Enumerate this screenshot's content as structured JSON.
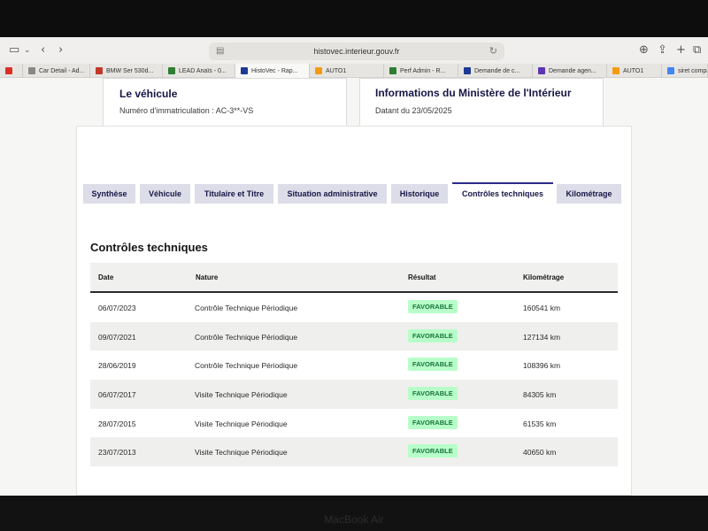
{
  "browser": {
    "url": "histovec.interieur.gouv.fr",
    "tabs": [
      {
        "label": "",
        "fav": "#d93025",
        "icon": "gmail-icon"
      },
      {
        "label": "Car Detail - Ad...",
        "fav": "#888888",
        "icon": "w-icon"
      },
      {
        "label": "BMW Ser 530d...",
        "fav": "#c0392b",
        "icon": "bmw-icon"
      },
      {
        "label": "LEAD Anaïs - 0...",
        "fav": "#2e7d32",
        "icon": "sheet-icon"
      },
      {
        "label": "HistoVec - Rap...",
        "fav": "#1f3a93",
        "icon": "flag-icon",
        "active": true
      },
      {
        "label": "AUTO1",
        "fav": "#f39c12",
        "icon": "auto1-icon"
      },
      {
        "label": "Perf Admin - R...",
        "fav": "#2e7d32",
        "icon": "sheet-icon"
      },
      {
        "label": "Demande de c...",
        "fav": "#1f3a93",
        "icon": "flag-icon"
      },
      {
        "label": "Demande agen...",
        "fav": "#5e35b1",
        "icon": "form-icon"
      },
      {
        "label": "AUTO1",
        "fav": "#f39c12",
        "icon": "auto1-icon"
      },
      {
        "label": "siret compagni...",
        "fav": "#4285f4",
        "icon": "google-icon"
      }
    ]
  },
  "vehicle_card": {
    "title": "Le véhicule",
    "text": "Numéro d'immatriculation : AC-3**-VS"
  },
  "ministry_card": {
    "title": "Informations du Ministère de l'Intérieur",
    "text": "Datant du 23/05/2025"
  },
  "tabs": [
    {
      "label": "Synthèse"
    },
    {
      "label": "Véhicule"
    },
    {
      "label": "Titulaire et Titre"
    },
    {
      "label": "Situation administrative"
    },
    {
      "label": "Historique"
    },
    {
      "label": "Contrôles techniques",
      "active": true
    },
    {
      "label": "Kilométrage"
    }
  ],
  "section": {
    "title": "Contrôles techniques",
    "columns": {
      "date": "Date",
      "nature": "Nature",
      "result": "Résultat",
      "km": "Kilométrage"
    },
    "rows": [
      {
        "date": "06/07/2023",
        "nature": "Contrôle Technique Périodique",
        "result": "FAVORABLE",
        "km": "160541 km"
      },
      {
        "date": "09/07/2021",
        "nature": "Contrôle Technique Périodique",
        "result": "FAVORABLE",
        "km": "127134 km"
      },
      {
        "date": "28/06/2019",
        "nature": "Contrôle Technique Périodique",
        "result": "FAVORABLE",
        "km": "108396 km"
      },
      {
        "date": "06/07/2017",
        "nature": "Visite Technique Périodique",
        "result": "FAVORABLE",
        "km": "84305 km"
      },
      {
        "date": "28/07/2015",
        "nature": "Visite Technique Périodique",
        "result": "FAVORABLE",
        "km": "61535 km"
      },
      {
        "date": "23/07/2013",
        "nature": "Visite Technique Périodique",
        "result": "FAVORABLE",
        "km": "40650 km"
      }
    ]
  },
  "device_brand": "MacBook Air",
  "colors": {
    "accent": "#161646",
    "badge_bg": "#b8fec9",
    "badge_text": "#18753c"
  }
}
